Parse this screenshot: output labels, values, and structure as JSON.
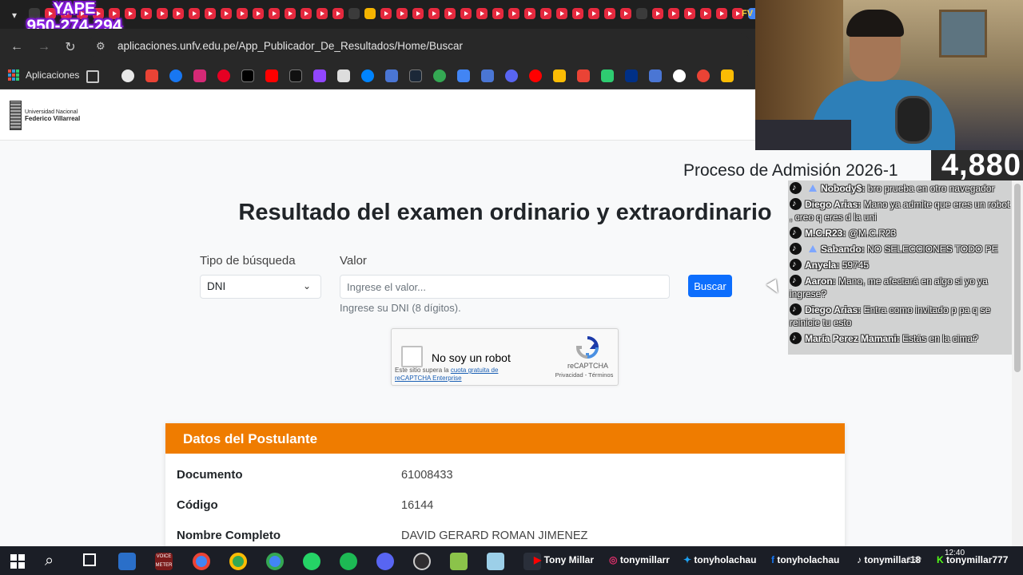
{
  "browser": {
    "overlay_yape": {
      "line1": "YAPE",
      "line2": "950-274-294"
    },
    "tab_overflow_icon": "chevron-down-icon",
    "tab_last_label": "FV",
    "url": "aplicaciones.unfv.edu.pe/App_Publicador_De_Resultados/Home/Buscar",
    "bookmarks": {
      "apps_label": "Aplicaciones"
    }
  },
  "site": {
    "logo_line1": "Universidad Nacional",
    "logo_line2": "Federico Villarreal",
    "process_title": "Proceso de Admisión 2026-1",
    "page_title": "Resultado del examen ordinario y extraordinario",
    "search": {
      "type_label": "Tipo de búsqueda",
      "type_value": "DNI",
      "value_label": "Valor",
      "value_placeholder": "Ingrese el valor...",
      "hint": "Ingrese su DNI (8 dígitos).",
      "button": "Buscar"
    },
    "captcha": {
      "label": "No soy un robot",
      "small_prefix": "Este sitio supera la ",
      "small_link": "cuota gratuita de reCAPTCHA Enterprise",
      "brand": "reCAPTCHA",
      "links": "Privacidad - Términos"
    },
    "applicant": {
      "header": "Datos del Postulante",
      "rows": [
        {
          "label": "Documento",
          "value": "61008433"
        },
        {
          "label": "Código",
          "value": "16144"
        },
        {
          "label": "Nombre Completo",
          "value": "DAVID GERARD ROMAN JIMENEZ"
        }
      ]
    }
  },
  "stream": {
    "viewer_count": "4,880",
    "chat": [
      {
        "user": "Nobody$:",
        "text": " bro prueba en otro navegador",
        "badge": true
      },
      {
        "user": "Diego Arias:",
        "text": " Mano ya admite que eres un robot , creo q eres d la uni",
        "badge": false
      },
      {
        "user": "M.C.R23:",
        "text": " @M.C.R23",
        "badge": false
      },
      {
        "user": "Sabando:",
        "text": " NO SELECCIONES TODO PE",
        "badge": true
      },
      {
        "user": "Anyela:",
        "text": " 59745",
        "badge": false
      },
      {
        "user": "Aaron:",
        "text": " Mano, me afectará en algo si yo ya ingrese?",
        "badge": false
      },
      {
        "user": "Diego Arias:",
        "text": " Entra como invitado p pa q se reinicie tu esto",
        "badge": false
      },
      {
        "user": "María Perez Mamani:",
        "text": " Estás en la cima?",
        "badge": false
      }
    ]
  },
  "taskbar": {
    "labels": [
      "Tony Millar",
      "tonymillarr",
      "tonyholachau",
      "tonyholachau",
      "tonymillar18",
      "tonymillar777"
    ],
    "app_label": "VOICE METER",
    "time": "12:40",
    "lang": "ESP"
  },
  "colors": {
    "accent_orange": "#ef7c00",
    "button_blue": "#0d6efd",
    "chrome_dark": "#1f1f1f"
  }
}
